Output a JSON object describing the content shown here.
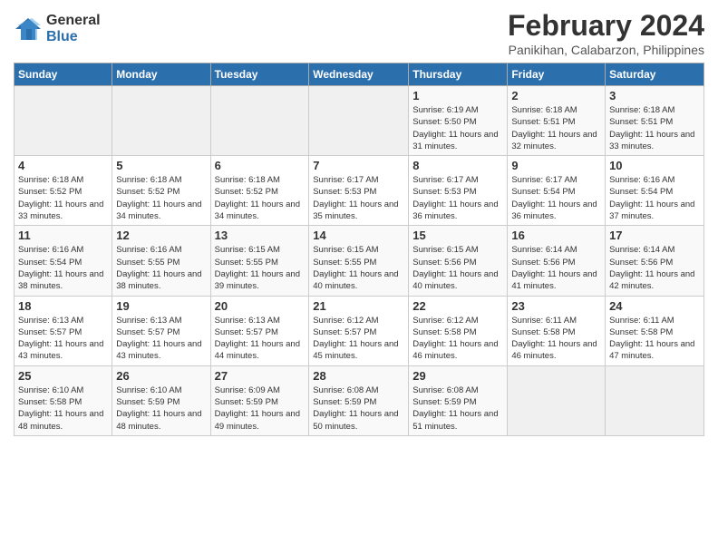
{
  "header": {
    "logo_general": "General",
    "logo_blue": "Blue",
    "month_year": "February 2024",
    "location": "Panikihan, Calabarzon, Philippines"
  },
  "days_of_week": [
    "Sunday",
    "Monday",
    "Tuesday",
    "Wednesday",
    "Thursday",
    "Friday",
    "Saturday"
  ],
  "weeks": [
    [
      {
        "day": "",
        "info": ""
      },
      {
        "day": "",
        "info": ""
      },
      {
        "day": "",
        "info": ""
      },
      {
        "day": "",
        "info": ""
      },
      {
        "day": "1",
        "info": "Sunrise: 6:19 AM\nSunset: 5:50 PM\nDaylight: 11 hours and 31 minutes."
      },
      {
        "day": "2",
        "info": "Sunrise: 6:18 AM\nSunset: 5:51 PM\nDaylight: 11 hours and 32 minutes."
      },
      {
        "day": "3",
        "info": "Sunrise: 6:18 AM\nSunset: 5:51 PM\nDaylight: 11 hours and 33 minutes."
      }
    ],
    [
      {
        "day": "4",
        "info": "Sunrise: 6:18 AM\nSunset: 5:52 PM\nDaylight: 11 hours and 33 minutes."
      },
      {
        "day": "5",
        "info": "Sunrise: 6:18 AM\nSunset: 5:52 PM\nDaylight: 11 hours and 34 minutes."
      },
      {
        "day": "6",
        "info": "Sunrise: 6:18 AM\nSunset: 5:52 PM\nDaylight: 11 hours and 34 minutes."
      },
      {
        "day": "7",
        "info": "Sunrise: 6:17 AM\nSunset: 5:53 PM\nDaylight: 11 hours and 35 minutes."
      },
      {
        "day": "8",
        "info": "Sunrise: 6:17 AM\nSunset: 5:53 PM\nDaylight: 11 hours and 36 minutes."
      },
      {
        "day": "9",
        "info": "Sunrise: 6:17 AM\nSunset: 5:54 PM\nDaylight: 11 hours and 36 minutes."
      },
      {
        "day": "10",
        "info": "Sunrise: 6:16 AM\nSunset: 5:54 PM\nDaylight: 11 hours and 37 minutes."
      }
    ],
    [
      {
        "day": "11",
        "info": "Sunrise: 6:16 AM\nSunset: 5:54 PM\nDaylight: 11 hours and 38 minutes."
      },
      {
        "day": "12",
        "info": "Sunrise: 6:16 AM\nSunset: 5:55 PM\nDaylight: 11 hours and 38 minutes."
      },
      {
        "day": "13",
        "info": "Sunrise: 6:15 AM\nSunset: 5:55 PM\nDaylight: 11 hours and 39 minutes."
      },
      {
        "day": "14",
        "info": "Sunrise: 6:15 AM\nSunset: 5:55 PM\nDaylight: 11 hours and 40 minutes."
      },
      {
        "day": "15",
        "info": "Sunrise: 6:15 AM\nSunset: 5:56 PM\nDaylight: 11 hours and 40 minutes."
      },
      {
        "day": "16",
        "info": "Sunrise: 6:14 AM\nSunset: 5:56 PM\nDaylight: 11 hours and 41 minutes."
      },
      {
        "day": "17",
        "info": "Sunrise: 6:14 AM\nSunset: 5:56 PM\nDaylight: 11 hours and 42 minutes."
      }
    ],
    [
      {
        "day": "18",
        "info": "Sunrise: 6:13 AM\nSunset: 5:57 PM\nDaylight: 11 hours and 43 minutes."
      },
      {
        "day": "19",
        "info": "Sunrise: 6:13 AM\nSunset: 5:57 PM\nDaylight: 11 hours and 43 minutes."
      },
      {
        "day": "20",
        "info": "Sunrise: 6:13 AM\nSunset: 5:57 PM\nDaylight: 11 hours and 44 minutes."
      },
      {
        "day": "21",
        "info": "Sunrise: 6:12 AM\nSunset: 5:57 PM\nDaylight: 11 hours and 45 minutes."
      },
      {
        "day": "22",
        "info": "Sunrise: 6:12 AM\nSunset: 5:58 PM\nDaylight: 11 hours and 46 minutes."
      },
      {
        "day": "23",
        "info": "Sunrise: 6:11 AM\nSunset: 5:58 PM\nDaylight: 11 hours and 46 minutes."
      },
      {
        "day": "24",
        "info": "Sunrise: 6:11 AM\nSunset: 5:58 PM\nDaylight: 11 hours and 47 minutes."
      }
    ],
    [
      {
        "day": "25",
        "info": "Sunrise: 6:10 AM\nSunset: 5:58 PM\nDaylight: 11 hours and 48 minutes."
      },
      {
        "day": "26",
        "info": "Sunrise: 6:10 AM\nSunset: 5:59 PM\nDaylight: 11 hours and 48 minutes."
      },
      {
        "day": "27",
        "info": "Sunrise: 6:09 AM\nSunset: 5:59 PM\nDaylight: 11 hours and 49 minutes."
      },
      {
        "day": "28",
        "info": "Sunrise: 6:08 AM\nSunset: 5:59 PM\nDaylight: 11 hours and 50 minutes."
      },
      {
        "day": "29",
        "info": "Sunrise: 6:08 AM\nSunset: 5:59 PM\nDaylight: 11 hours and 51 minutes."
      },
      {
        "day": "",
        "info": ""
      },
      {
        "day": "",
        "info": ""
      }
    ]
  ]
}
